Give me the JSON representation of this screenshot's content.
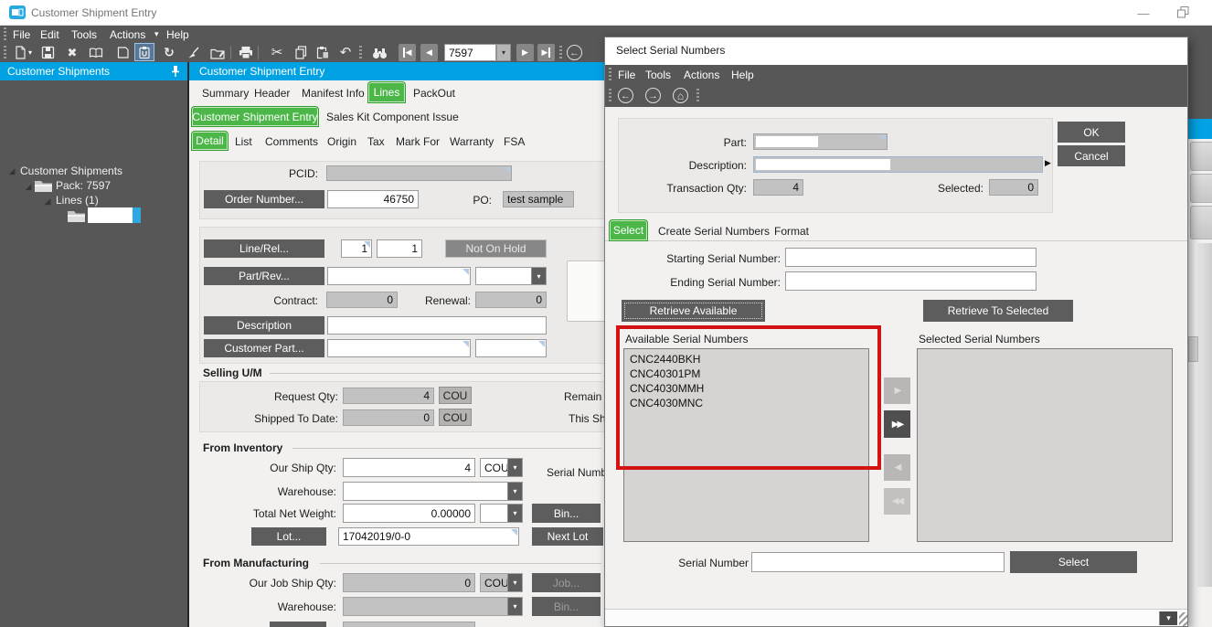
{
  "window": {
    "title": "Customer Shipment Entry",
    "menu": [
      "File",
      "Edit",
      "Tools",
      "Actions",
      "Help"
    ],
    "nav_value": "7597"
  },
  "sidebar": {
    "header": "Customer Shipments",
    "tree": {
      "root": "Customer Shipments",
      "pack": "Pack: 7597",
      "lines": "Lines (1)"
    }
  },
  "main": {
    "header": "Customer Shipment Entry",
    "tabs_row1": [
      "Summary",
      "Header",
      "Manifest Info",
      "Lines",
      "PackOut"
    ],
    "tabs_row2": [
      "Customer Shipment Entry",
      "Sales Kit Component Issue"
    ],
    "tabs_row3": [
      "Detail",
      "List",
      "Comments",
      "Origin",
      "Tax",
      "Mark For",
      "Warranty",
      "FSA"
    ],
    "form": {
      "pcid_label": "PCID:",
      "order_number_button": "Order Number...",
      "order_number_value": "46750",
      "po_label": "PO:",
      "po_value": "test sample",
      "line_rel_button": "Line/Rel...",
      "line_value": "1",
      "rel_value": "1",
      "hold_status": "Not On Hold",
      "part_rev_button": "Part/Rev...",
      "contract_label": "Contract:",
      "contract_value": "0",
      "renewal_label": "Renewal:",
      "renewal_value": "0",
      "description_button": "Description",
      "customer_part_button": "Customer Part...",
      "selling_um_header": "Selling U/M",
      "request_qty_label": "Request Qty:",
      "request_qty_value": "4",
      "request_qty_uom": "COU",
      "remain_label": "Remain",
      "shipped_label": "Shipped To Date:",
      "shipped_value": "0",
      "shipped_uom": "COU",
      "this_sh_label": "This Sh",
      "from_inventory_header": "From Inventory",
      "our_ship_qty_label": "Our Ship Qty:",
      "our_ship_qty_value": "4",
      "our_ship_uom": "COU",
      "serial_number_label": "Serial Numbe",
      "warehouse_label": "Warehouse:",
      "total_net_weight_label": "Total Net Weight:",
      "total_net_weight_value": "0.00000",
      "bin_button": "Bin...",
      "lot_button": "Lot...",
      "lot_value": "17042019/0-0",
      "next_lot_button": "Next Lot",
      "from_manufacturing_header": "From Manufacturing",
      "our_job_ship_qty_label": "Our Job Ship Qty:",
      "our_job_ship_qty_value": "0",
      "job_uom": "COU",
      "job_button": "Job...",
      "warehouse2_label": "Warehouse:",
      "bin2_button": "Bin..."
    }
  },
  "dialog": {
    "title": "Select Serial Numbers",
    "menu": [
      "File",
      "Tools",
      "Actions",
      "Help"
    ],
    "part_label": "Part:",
    "description_label": "Description:",
    "transaction_qty_label": "Transaction Qty:",
    "transaction_qty_value": "4",
    "selected_label": "Selected:",
    "selected_value": "0",
    "ok_button": "OK",
    "cancel_button": "Cancel",
    "tabs": [
      "Select",
      "Create Serial Numbers",
      "Format"
    ],
    "starting_label": "Starting Serial Number:",
    "ending_label": "Ending Serial Number:",
    "retrieve_available_button": "Retrieve Available",
    "retrieve_to_selected_button": "Retrieve To Selected",
    "available_label": "Available Serial Numbers",
    "available_items": [
      "CNC2440BKH",
      "CNC40301PM",
      "CNC4030MMH",
      "CNC4030MNC"
    ],
    "selected_list_label": "Selected Serial Numbers",
    "serial_number_label": "Serial Number",
    "select_button": "Select"
  },
  "icons": {
    "delete": "✖",
    "refresh": "↻",
    "cut": "✂",
    "undo": "↶",
    "back": "←",
    "forward": "→",
    "home": "⌂",
    "dropdown": "▾",
    "menu_caret": "▾",
    "expander": "◢",
    "nav_prev": "◀",
    "nav_next": "▶",
    "transfer_right": "▶",
    "transfer_right_all": "▶▶",
    "transfer_left": "◀",
    "transfer_left_all": "◀◀",
    "minimize": "—",
    "description_expand": "▶"
  },
  "colors": {
    "accent_blue": "#00a2e3",
    "accent_green": "#4cb748",
    "chrome_dark": "#575757",
    "annotation_red": "#d31313"
  }
}
